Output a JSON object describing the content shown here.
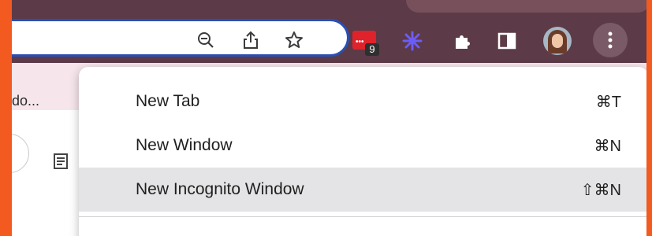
{
  "colors": {
    "frame": "#f25a1f",
    "chrome_bg": "#5c3a47",
    "omnibox_border": "#2a4fb4",
    "menu_bg": "#ffffff",
    "menu_hover": "#e4e4e6"
  },
  "toolbar": {
    "omnibox_icons": [
      "zoom-out-icon",
      "share-icon",
      "bookmark-star-icon"
    ],
    "extensions": {
      "todoist_badge": "9",
      "icons": [
        "todoist-extension-icon",
        "sparkle-extension-icon",
        "extensions-puzzle-icon",
        "side-panel-icon",
        "profile-avatar",
        "more-options-icon"
      ]
    }
  },
  "bookmarks_bar": {
    "partial_label": "do..."
  },
  "menu": {
    "items": [
      {
        "label": "New Tab",
        "shortcut": "⌘T"
      },
      {
        "label": "New Window",
        "shortcut": "⌘N"
      },
      {
        "label": "New Incognito Window",
        "shortcut": "⇧⌘N"
      }
    ]
  }
}
